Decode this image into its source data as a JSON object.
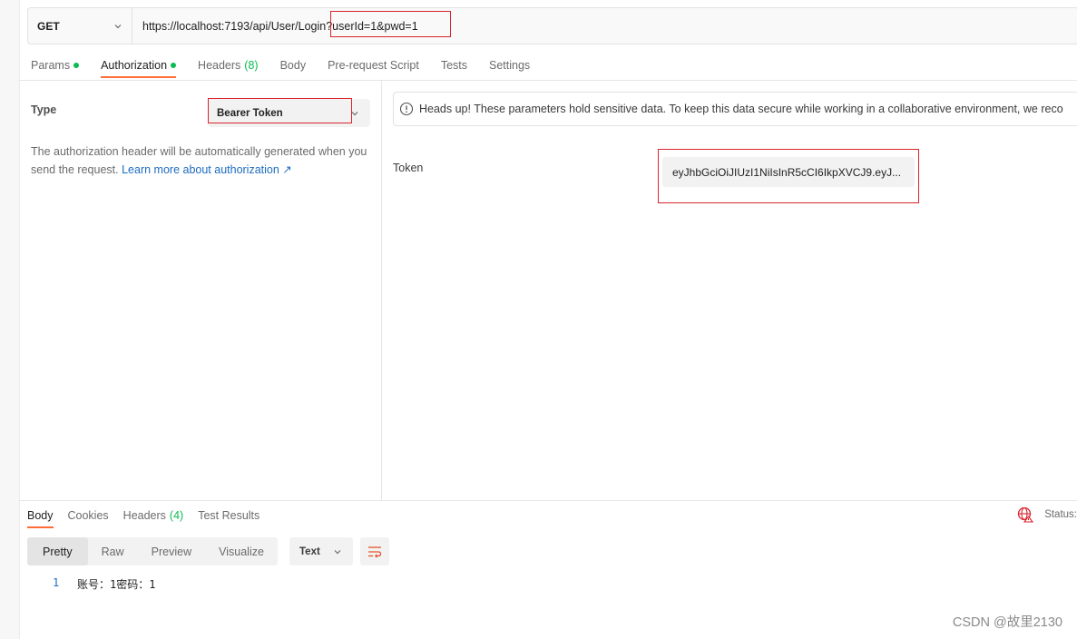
{
  "request": {
    "method": "GET",
    "url_base": "https://localhost:7193/api/User/Login",
    "url_query": "?userId=1&pwd=1"
  },
  "request_tabs": [
    {
      "label": "Params",
      "dot": true
    },
    {
      "label": "Authorization",
      "dot": true,
      "active": true
    },
    {
      "label": "Headers",
      "count": "(8)"
    },
    {
      "label": "Body"
    },
    {
      "label": "Pre-request Script"
    },
    {
      "label": "Tests"
    },
    {
      "label": "Settings"
    }
  ],
  "auth": {
    "type_label": "Type",
    "type_value": "Bearer Token",
    "description": "The authorization header will be automatically generated when you send the request.",
    "learn_more": "Learn more about authorization ↗",
    "banner": "Heads up! These parameters hold sensitive data. To keep this data secure while working in a collaborative environment, we reco",
    "token_label": "Token",
    "token_value": "eyJhbGciOiJIUzI1NiIsInR5cCI6IkpXVCJ9.eyJ..."
  },
  "response_tabs": [
    {
      "label": "Body",
      "active": true
    },
    {
      "label": "Cookies"
    },
    {
      "label": "Headers",
      "count": "(4)"
    },
    {
      "label": "Test Results"
    }
  ],
  "response": {
    "status_label": "Status:",
    "views": [
      "Pretty",
      "Raw",
      "Preview",
      "Visualize"
    ],
    "active_view": "Pretty",
    "format": "Text",
    "line_number": "1",
    "line_text": "账号：1密码：1"
  },
  "watermark": "CSDN @故里2130",
  "colors": {
    "accent": "#ff6c37",
    "green": "#0cbb52",
    "link": "#1d6cbf",
    "highlight_box": "#d9252c"
  }
}
